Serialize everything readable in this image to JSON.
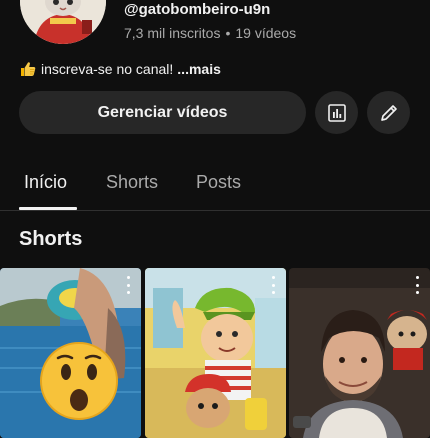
{
  "channel": {
    "handle": "@gatobombeiro-u9n",
    "subscribers": "7,3 mil inscritos",
    "separator": "•",
    "videos": "19 vídeos",
    "description": "inscreva-se no canal!",
    "more_label": "...mais"
  },
  "actions": {
    "manage_label": "Gerenciar vídeos",
    "analytics_icon": "analytics-icon",
    "edit_icon": "pencil-icon"
  },
  "tabs": [
    {
      "label": "Início",
      "active": true
    },
    {
      "label": "Shorts",
      "active": false
    },
    {
      "label": "Posts",
      "active": false
    }
  ],
  "shorts_section": {
    "title": "Shorts"
  },
  "colors": {
    "background": "#0f0f0f",
    "button_bg": "#272727",
    "text_primary": "#f1f1f1",
    "text_secondary": "#aaaaaa"
  }
}
